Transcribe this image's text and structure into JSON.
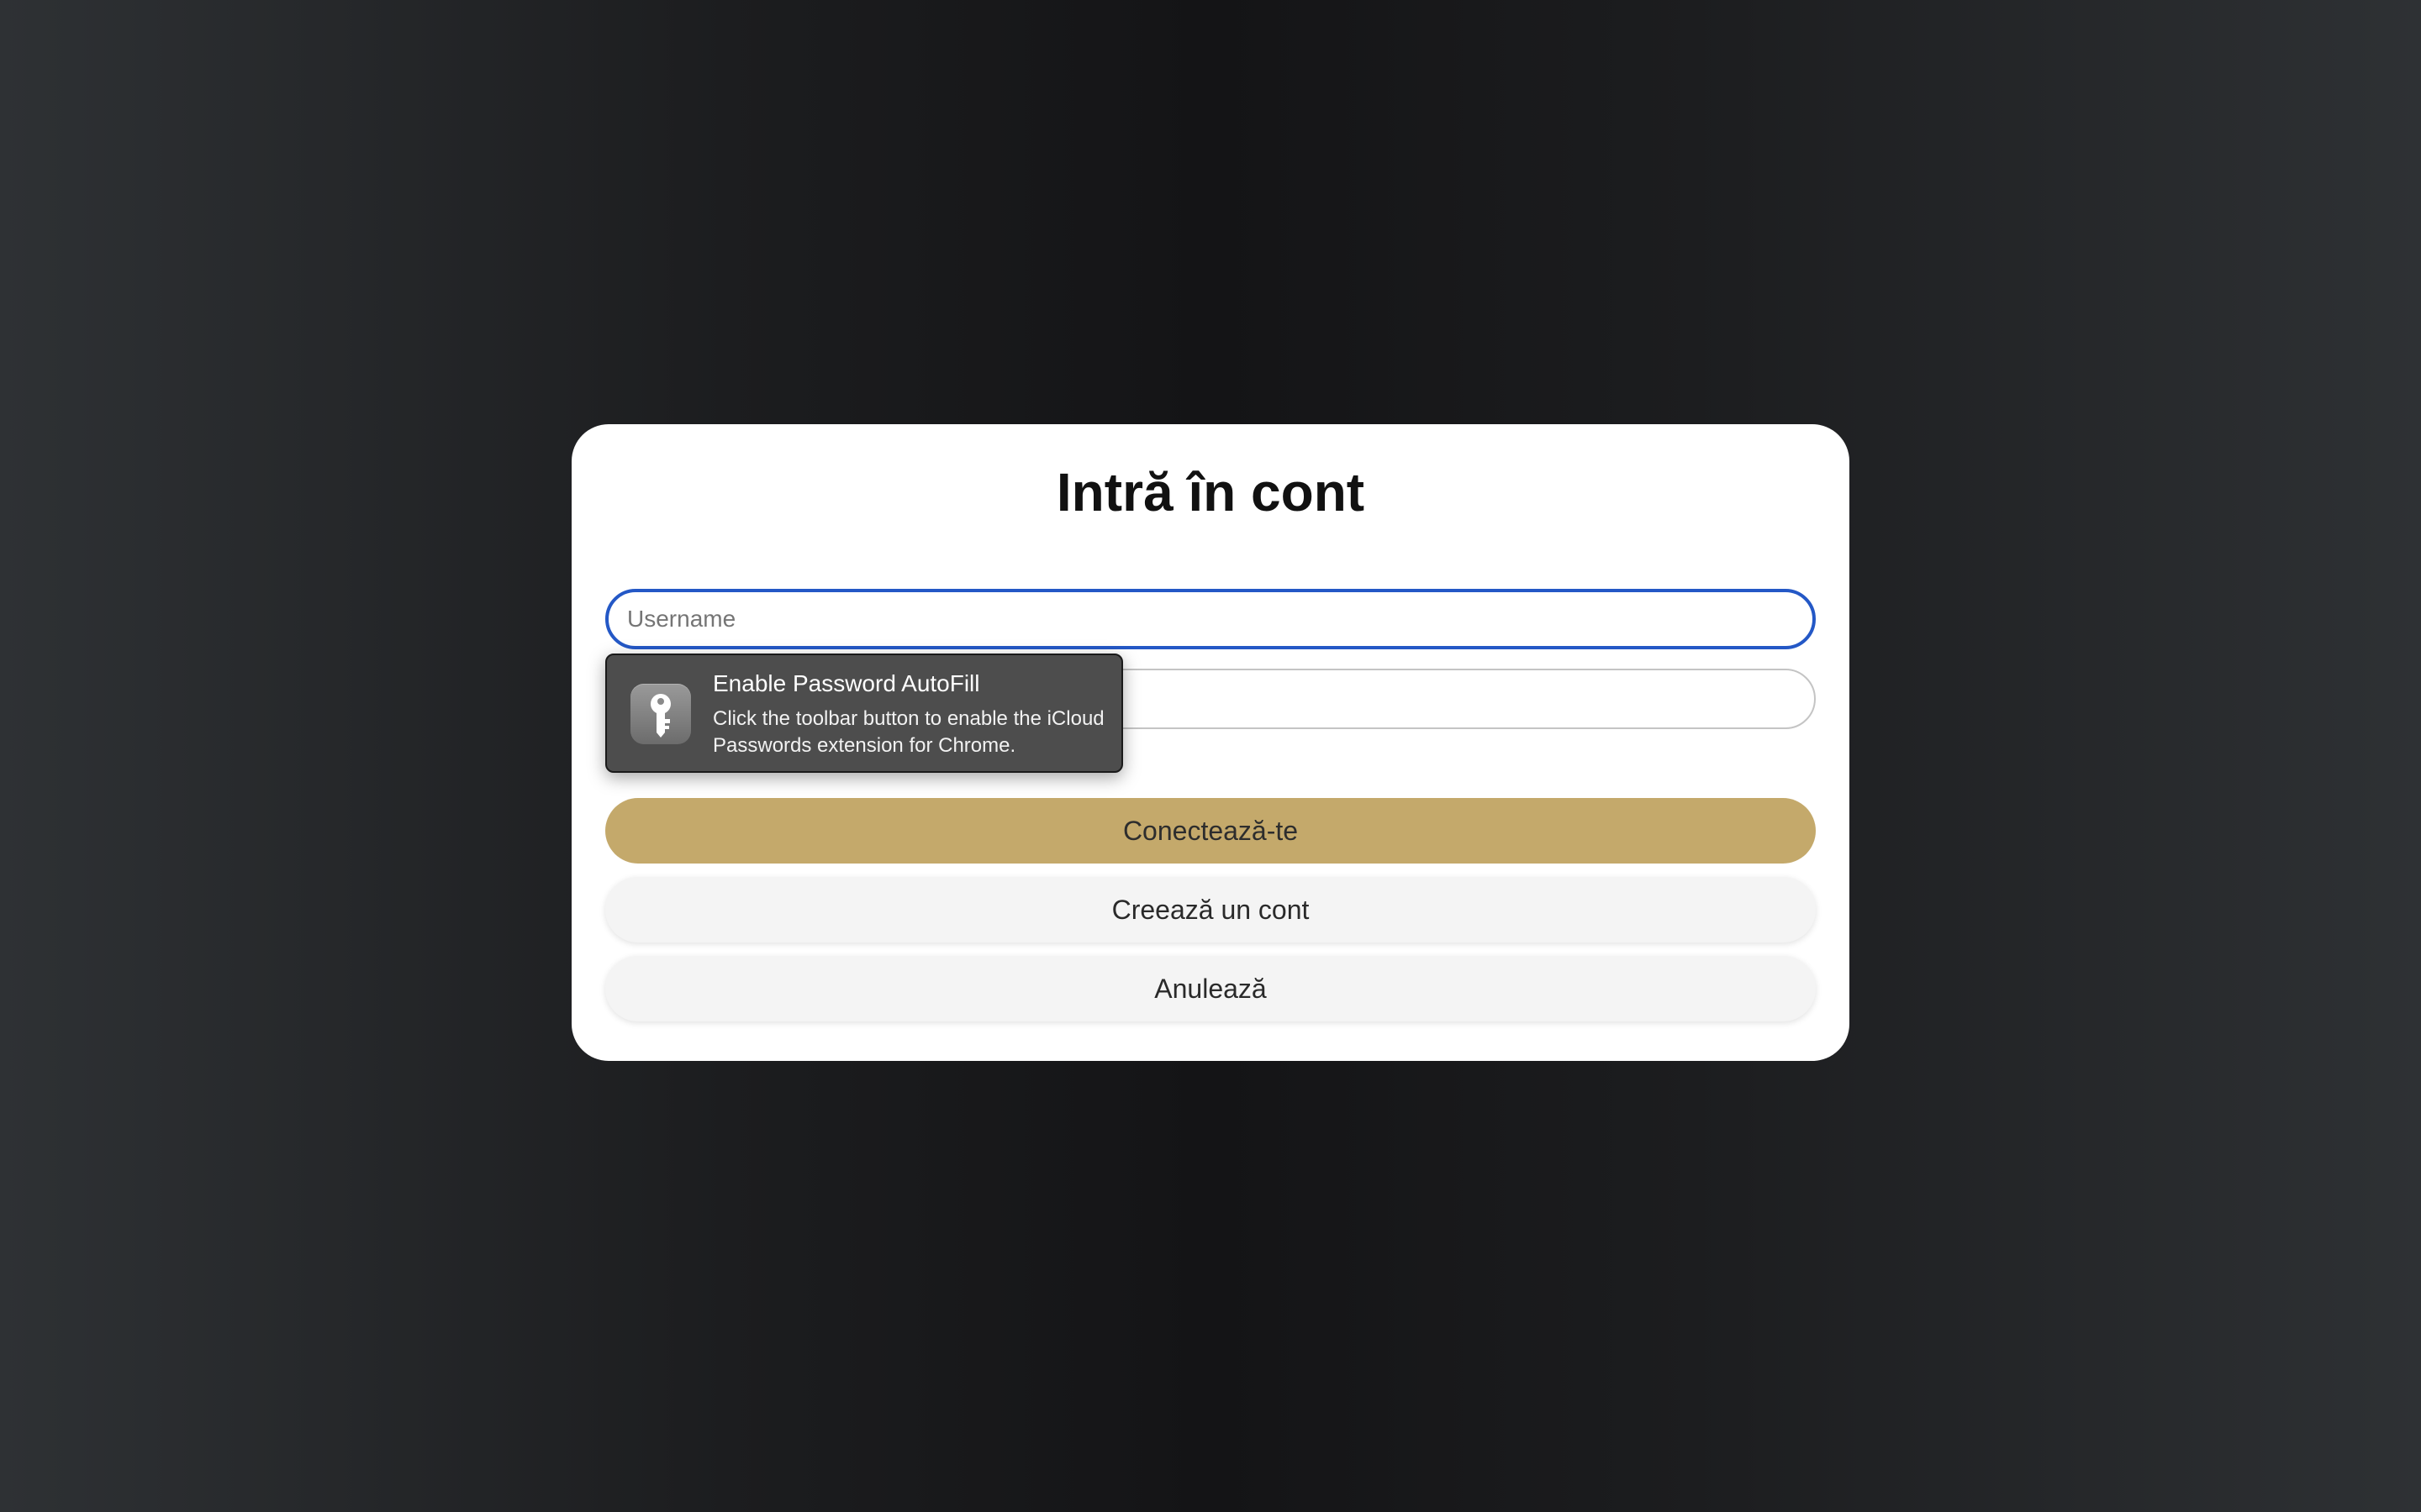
{
  "login": {
    "title": "Intră în cont",
    "username_placeholder": "Username",
    "password_placeholder": "",
    "connect_label": "Conectează-te",
    "create_account_label": "Creează un cont",
    "cancel_label": "Anulează"
  },
  "autofill": {
    "icon": "key-icon",
    "title": "Enable Password AutoFill",
    "description": "Click the toolbar button to enable the iCloud Passwords extension for Chrome."
  },
  "colors": {
    "primary_button": "#c4a96b",
    "focus_border": "#2458c6",
    "tooltip_bg": "#4d4d4d"
  }
}
